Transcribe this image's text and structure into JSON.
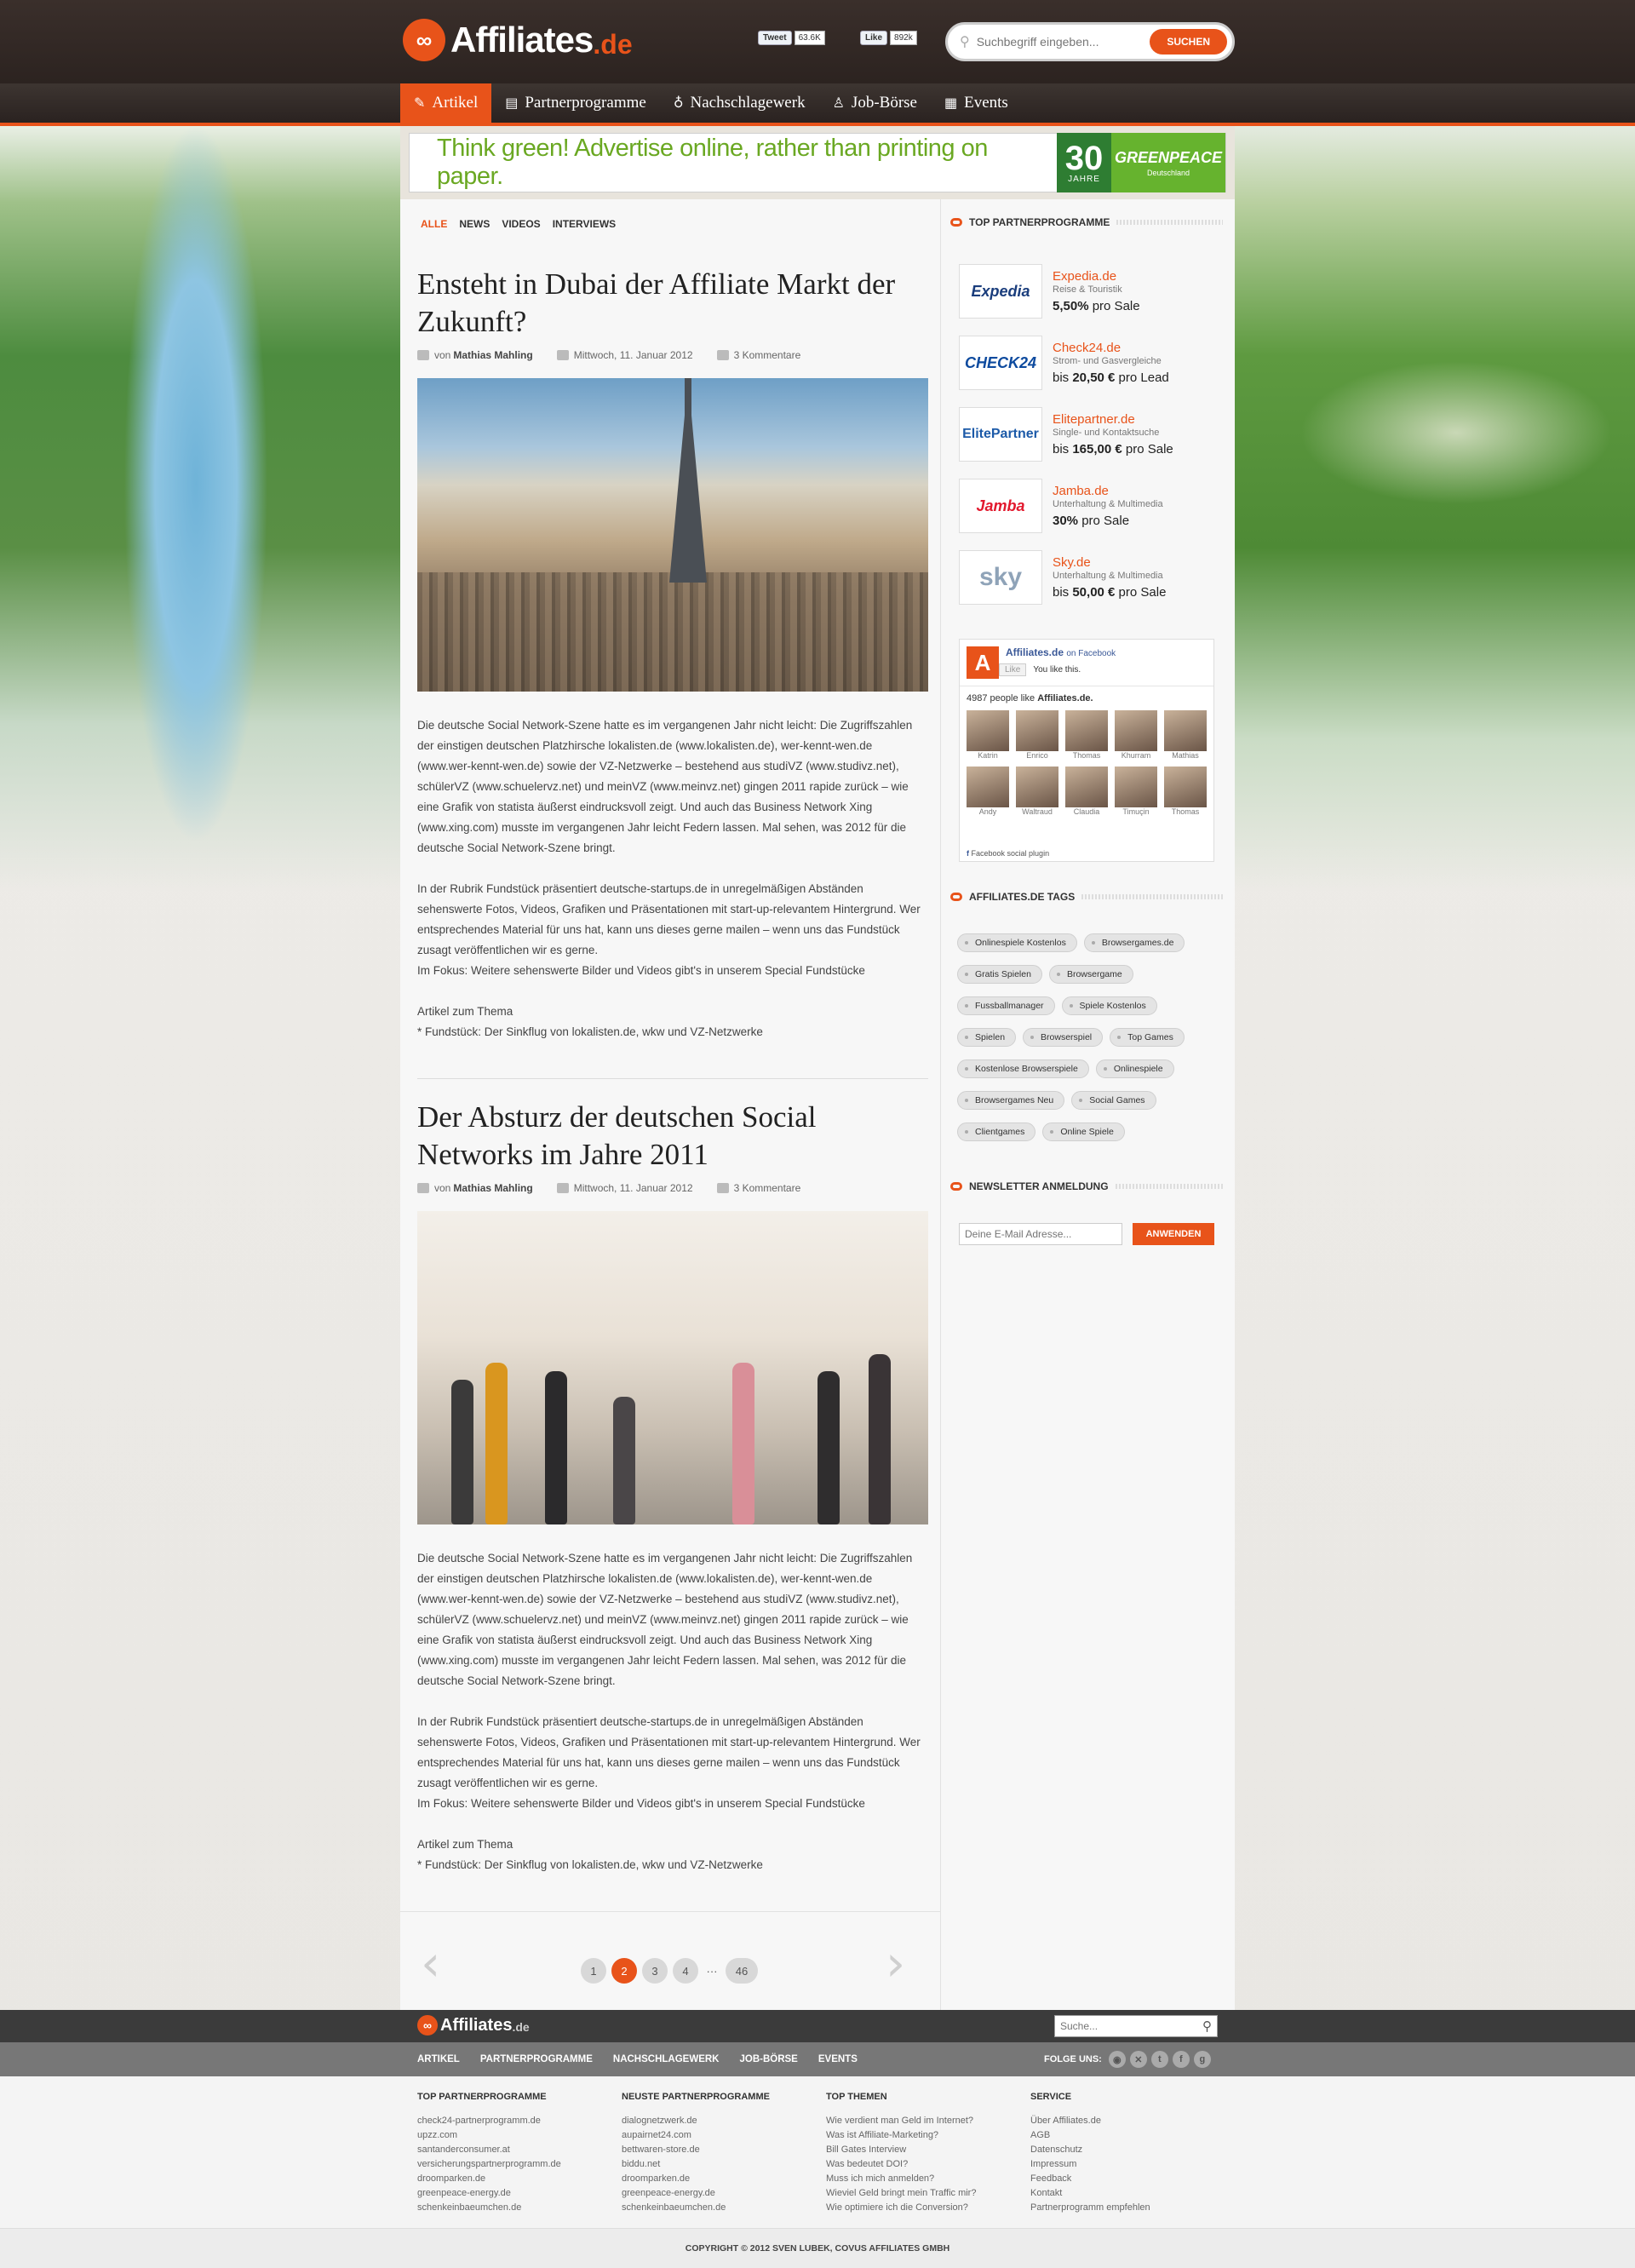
{
  "header": {
    "logo_text": "Affiliates",
    "logo_tld": ".de",
    "tweet_label": "Tweet",
    "tweet_count": "63.6K",
    "like_label": "Like",
    "like_count": "892k",
    "search_placeholder": "Suchbegriff eingeben...",
    "search_button": "SUCHEN"
  },
  "nav": {
    "items": [
      {
        "label": "Artikel",
        "icon": "pencil-icon"
      },
      {
        "label": "Partnerprogramme",
        "icon": "clipboard-icon"
      },
      {
        "label": "Nachschlagewerk",
        "icon": "lightbulb-icon"
      },
      {
        "label": "Job-Börse",
        "icon": "person-icon"
      },
      {
        "label": "Events",
        "icon": "calendar-icon"
      }
    ]
  },
  "banner": {
    "text": "Think green! Advertise online, rather than printing on paper.",
    "number": "30",
    "number_sub": "JAHRE",
    "brand": "GREENPEACE",
    "brand_sub": "Deutschland"
  },
  "filter": [
    "ALLE",
    "NEWS",
    "VIDEOS",
    "INTERVIEWS"
  ],
  "articles": [
    {
      "title": "Ensteht in Dubai der Affiliate Markt der Zukunft?",
      "author_prefix": "von",
      "author": "Mathias Mahling",
      "date": "Mittwoch, 11. Januar 2012",
      "comments": "3 Kommentare",
      "p1": "Die deutsche Social Network-Szene hatte es im vergangenen Jahr nicht leicht: Die Zugriffszahlen der einstigen deutschen Platzhirsche lokalisten.de (www.lokalisten.de), wer-kennt-wen.de (www.wer-kennt-wen.de) sowie der VZ-Netzwerke – bestehend aus studiVZ (www.studivz.net), schülerVZ (www.schuelervz.net) und meinVZ (www.meinvz.net) gingen 2011 rapide zurück – wie eine Grafik von statista äußerst eindrucksvoll zeigt. Und auch das Business Network Xing (www.xing.com) musste im vergangenen Jahr leicht Federn lassen. Mal sehen, was 2012 für die deutsche Social Network-Szene bringt.",
      "p2": "In der Rubrik Fundstück präsentiert deutsche-startups.de in unregelmäßigen Abständen sehenswerte Fotos, Videos, Grafiken und Präsentationen mit start-up-relevantem Hintergrund. Wer entsprechendes Material für uns hat, kann uns dieses gerne mailen – wenn uns das Fundstück zusagt veröffentlichen wir es gerne.",
      "p2b": "Im Fokus: Weitere sehenswerte Bilder und Videos gibt's in unserem Special Fundstücke",
      "p3": "Artikel zum Thema",
      "p3b": "* Fundstück: Der Sinkflug von lokalisten.de, wkw und VZ-Netzwerke"
    },
    {
      "title": "Der Absturz der deutschen Social Networks im Jahre 2011",
      "author_prefix": "von",
      "author": "Mathias Mahling",
      "date": "Mittwoch, 11. Januar 2012",
      "comments": "3 Kommentare",
      "p1": "Die deutsche Social Network-Szene hatte es im vergangenen Jahr nicht leicht: Die Zugriffszahlen der einstigen deutschen Platzhirsche lokalisten.de (www.lokalisten.de), wer-kennt-wen.de (www.wer-kennt-wen.de) sowie der VZ-Netzwerke – bestehend aus studiVZ (www.studivz.net), schülerVZ (www.schuelervz.net) und meinVZ (www.meinvz.net) gingen 2011 rapide zurück – wie eine Grafik von statista äußerst eindrucksvoll zeigt. Und auch das Business Network Xing (www.xing.com) musste im vergangenen Jahr leicht Federn lassen. Mal sehen, was 2012 für die deutsche Social Network-Szene bringt.",
      "p2": "In der Rubrik Fundstück präsentiert deutsche-startups.de in unregelmäßigen Abständen sehenswerte Fotos, Videos, Grafiken und Präsentationen mit start-up-relevantem Hintergrund. Wer entsprechendes Material für uns hat, kann uns dieses gerne mailen – wenn uns das Fundstück zusagt veröffentlichen wir es gerne.",
      "p2b": "Im Fokus: Weitere sehenswerte Bilder und Videos gibt's in unserem Special Fundstücke",
      "p3": "Artikel zum Thema",
      "p3b": "* Fundstück: Der Sinkflug von lokalisten.de, wkw und VZ-Netzwerke"
    }
  ],
  "pagination": [
    "1",
    "2",
    "3",
    "4",
    "···",
    "46"
  ],
  "sidebar": {
    "top_title": "TOP PARTNERPROGRAMME",
    "partners": [
      {
        "logo": "Expedia",
        "name": "Expedia.de",
        "desc": "Reise & Touristik",
        "deal_pre": "",
        "deal_value": "5,50%",
        "deal_post": " pro Sale",
        "color": "#1a3d7c"
      },
      {
        "logo": "CHECK24",
        "name": "Check24.de",
        "desc": "Strom- und Gasvergleiche",
        "deal_pre": "bis ",
        "deal_value": "20,50 €",
        "deal_post": " pro Lead",
        "color": "#0d4a9e"
      },
      {
        "logo": "ElitePartner",
        "name": "Elitepartner.de",
        "desc": "Single- und Kontaktsuche",
        "deal_pre": "bis ",
        "deal_value": "165,00 €",
        "deal_post": " pro Sale",
        "color": "#1c5aa8"
      },
      {
        "logo": "Jamba",
        "name": "Jamba.de",
        "desc": "Unterhaltung & Multimedia",
        "deal_pre": "",
        "deal_value": "30%",
        "deal_post": " pro Sale",
        "color": "#e2182d"
      },
      {
        "logo": "sky",
        "name": "Sky.de",
        "desc": "Unterhaltung & Multimedia",
        "deal_pre": "bis ",
        "deal_value": "50,00 €",
        "deal_post": " pro Sale",
        "color": "#8fa3b8"
      }
    ],
    "facebook": {
      "page": "Affiliates.de",
      "on": "on Facebook",
      "like": "Like",
      "you_like": "You like this.",
      "count": "4987 people like",
      "count_page": "Affiliates.de.",
      "faces": [
        "Katrin",
        "Enrico",
        "Thomas",
        "Khurram",
        "Mathias",
        "Andy",
        "Waltraud",
        "Claudia",
        "Timuçin",
        "Thomas"
      ],
      "plugin": "Facebook social plugin"
    },
    "tags_title": "AFFILIATES.DE TAGS",
    "tags": [
      "Onlinespiele Kostenlos",
      "Browsergames.de",
      "Gratis Spielen",
      "Browsergame",
      "Fussballmanager",
      "Spiele Kostenlos",
      "Spielen",
      "Browserspiel",
      "Top Games",
      "Kostenlose Browserspiele",
      "Onlinespiele",
      "Browsergames Neu",
      "Social Games",
      "Clientgames",
      "Online Spiele"
    ],
    "newsletter_title": "NEWSLETTER ANMELDUNG",
    "newsletter_placeholder": "Deine E-Mail Adresse...",
    "newsletter_button": "ANWENDEN"
  },
  "footer": {
    "logo_text": "Affiliates",
    "logo_tld": ".de",
    "search_placeholder": "Suche...",
    "links": [
      "ARTIKEL",
      "PARTNERPROGRAMME",
      "NACHSCHLAGEWERK",
      "JOB-BÖRSE",
      "EVENTS"
    ],
    "follow": "FOLGE UNS:",
    "columns": [
      {
        "title": "TOP PARTNERPROGRAMME",
        "items": [
          "check24-partnerprogramm.de",
          "upzz.com",
          "santanderconsumer.at",
          "versicherungspartnerprogramm.de",
          "droomparken.de",
          "greenpeace-energy.de",
          "schenkeinbaeumchen.de"
        ]
      },
      {
        "title": "NEUSTE PARTNERPROGRAMME",
        "items": [
          "dialognetzwerk.de",
          "aupairnet24.com",
          "bettwaren-store.de",
          "biddu.net",
          "droomparken.de",
          "greenpeace-energy.de",
          "schenkeinbaeumchen.de"
        ]
      },
      {
        "title": "TOP THEMEN",
        "items": [
          "Wie verdient man Geld im Internet?",
          "Was ist Affiliate-Marketing?",
          "Bill Gates Interview",
          "Was bedeutet DOI?",
          "Muss ich mich anmelden?",
          "Wieviel Geld bringt mein Traffic mir?",
          "Wie optimiere ich die Conversion?"
        ]
      },
      {
        "title": "SERVICE",
        "items": [
          "Über Affiliates.de",
          "AGB",
          "Datenschutz",
          "Impressum",
          "Feedback",
          "Kontakt",
          "Partnerprogramm empfehlen"
        ]
      }
    ],
    "copyright": "COPYRIGHT © 2012 SVEN LUBEK, COVUS AFFILIATES GMBH"
  }
}
